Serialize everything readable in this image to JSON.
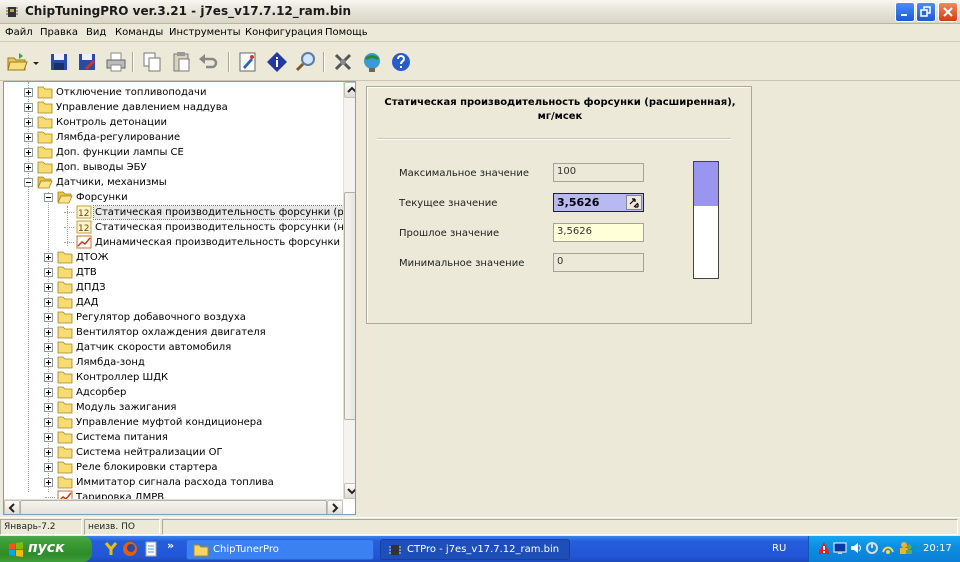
{
  "window": {
    "title": "ChipTuningPRO ver.3.21 - j7es_v17.7.12_ram.bin",
    "icon": "chip-icon"
  },
  "menu": [
    "Файл",
    "Правка",
    "Вид",
    "Команды",
    "Инструменты",
    "Конфигурация",
    "Помощь"
  ],
  "toolbar": {
    "buttons": [
      "open-icon",
      "dropdown-arrow-icon",
      "save-icon",
      "save-as-icon",
      "print-icon",
      "copy-icon",
      "paste-icon",
      "undo-icon",
      "properties-icon",
      "info-icon",
      "search-icon",
      "settings-icon",
      "network-icon",
      "help-icon"
    ]
  },
  "tree": {
    "items": [
      {
        "label": "Отключение топливоподачи",
        "level": 1,
        "type": "folder",
        "expanded": false
      },
      {
        "label": "Управление давлением наддува",
        "level": 1,
        "type": "folder",
        "expanded": false
      },
      {
        "label": "Контроль детонации",
        "level": 1,
        "type": "folder",
        "expanded": false
      },
      {
        "label": "Лямбда-регулирование",
        "level": 1,
        "type": "folder",
        "expanded": false
      },
      {
        "label": "Доп. функции лампы CE",
        "level": 1,
        "type": "folder",
        "expanded": false
      },
      {
        "label": "Доп. выводы ЭБУ",
        "level": 1,
        "type": "folder",
        "expanded": false
      },
      {
        "label": "Датчики, механизмы",
        "level": 1,
        "type": "folder",
        "expanded": true
      },
      {
        "label": "Форсунки",
        "level": 2,
        "type": "folder",
        "expanded": true
      },
      {
        "label": "Статическая производительность форсунки (расш",
        "level": 3,
        "type": "value",
        "selected": true
      },
      {
        "label": "Статическая производительность форсунки (не ис",
        "level": 3,
        "type": "value"
      },
      {
        "label": "Динамическая производительность форсунки",
        "level": 3,
        "type": "table"
      },
      {
        "label": "ДТОЖ",
        "level": 2,
        "type": "folder",
        "expanded": false
      },
      {
        "label": "ДТВ",
        "level": 2,
        "type": "folder",
        "expanded": false
      },
      {
        "label": "ДПДЗ",
        "level": 2,
        "type": "folder",
        "expanded": false
      },
      {
        "label": "ДАД",
        "level": 2,
        "type": "folder",
        "expanded": false
      },
      {
        "label": "Регулятор добавочного воздуха",
        "level": 2,
        "type": "folder",
        "expanded": false
      },
      {
        "label": "Вентилятор охлаждения двигателя",
        "level": 2,
        "type": "folder",
        "expanded": false
      },
      {
        "label": "Датчик скорости автомобиля",
        "level": 2,
        "type": "folder",
        "expanded": false
      },
      {
        "label": "Лямбда-зонд",
        "level": 2,
        "type": "folder",
        "expanded": false
      },
      {
        "label": "Контроллер ШДК",
        "level": 2,
        "type": "folder",
        "expanded": false
      },
      {
        "label": "Адсорбер",
        "level": 2,
        "type": "folder",
        "expanded": false
      },
      {
        "label": "Модуль зажигания",
        "level": 2,
        "type": "folder",
        "expanded": false
      },
      {
        "label": "Управление муфтой кондиционера",
        "level": 2,
        "type": "folder",
        "expanded": false
      },
      {
        "label": "Система питания",
        "level": 2,
        "type": "folder",
        "expanded": false
      },
      {
        "label": "Система нейтрализации ОГ",
        "level": 2,
        "type": "folder",
        "expanded": false
      },
      {
        "label": "Реле блокировки стартера",
        "level": 2,
        "type": "folder",
        "expanded": false
      },
      {
        "label": "Иммитатор сигнала расхода топлива",
        "level": 2,
        "type": "folder",
        "expanded": false
      },
      {
        "label": "Тарировка ДМРВ",
        "level": 2,
        "type": "table"
      }
    ]
  },
  "detail": {
    "heading_line1": "Статическая производительность форсунки (расширенная),",
    "heading_line2": "мг/мсек",
    "max_label": "Максимальное значение",
    "max_value": "100",
    "current_label": "Текущее значение",
    "current_value": "3,5626",
    "previous_label": "Прошлое значение",
    "previous_value": "3,5626",
    "min_label": "Минимальное значение",
    "min_value": "0",
    "level_fraction": 0.38,
    "colors": {
      "current_bg": "#b8b8f4",
      "previous_bg": "#ffffd8",
      "level_fill": "#9a96f0"
    }
  },
  "status": {
    "cell1": "Январь-7.2",
    "cell2": "неизв. ПО"
  },
  "taskbar": {
    "start_label": "пуск",
    "quicklaunch_overflow": "»",
    "task1": "ChipTunerPro",
    "task2": "CTPro - j7es_v17.7.12_ram.bin",
    "lang": "RU",
    "clock": "20:17"
  }
}
